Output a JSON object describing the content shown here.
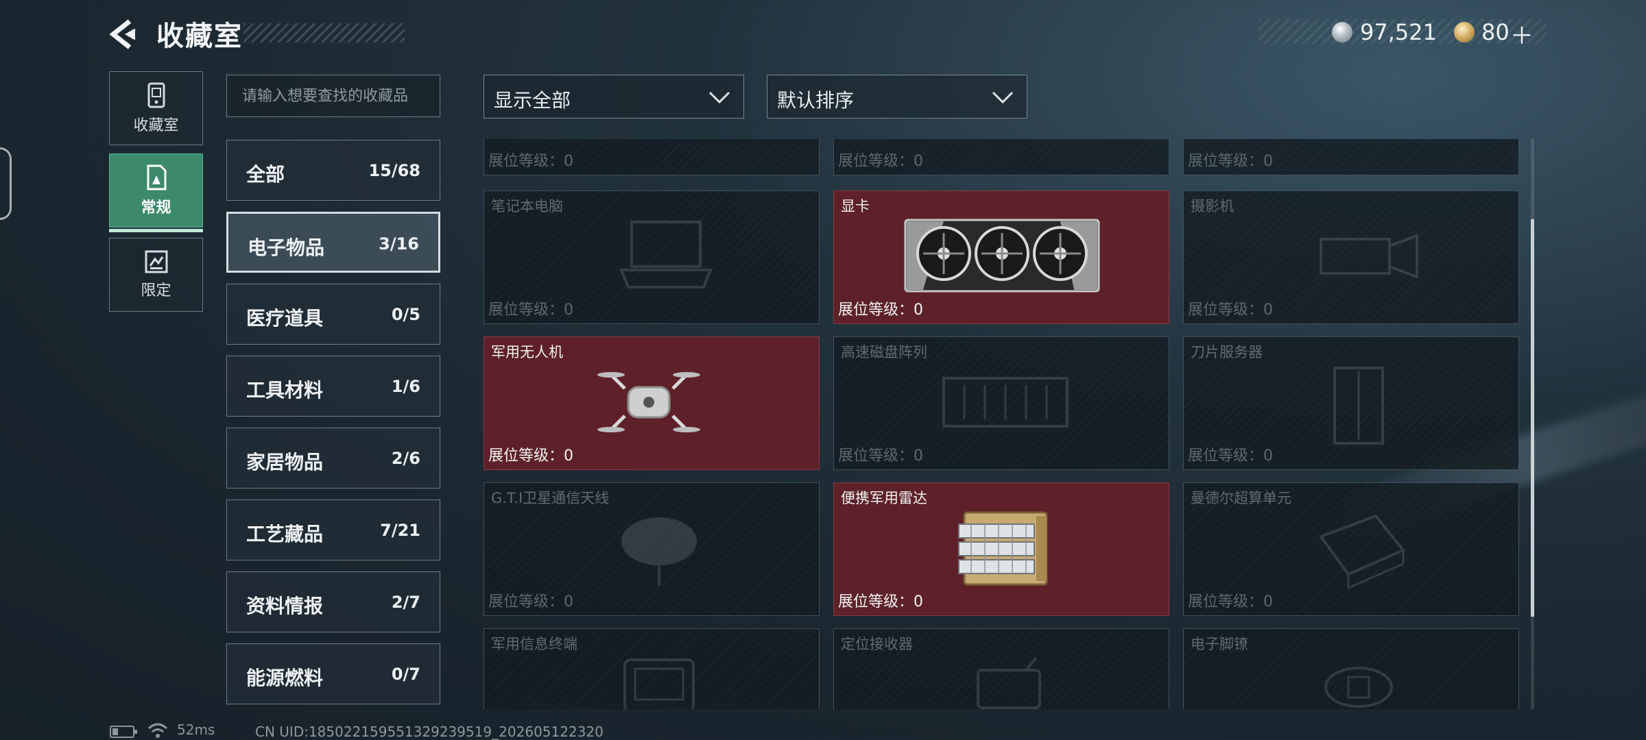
{
  "header": {
    "title": "收藏室",
    "back_icon": "back-arrow-icon"
  },
  "currency": {
    "silver_amount": "97,521",
    "gold_amount": "80",
    "gold_plus": "＋",
    "silver_icon": "silver-coin-icon",
    "gold_icon": "gold-coin-icon"
  },
  "side_tabs": [
    {
      "label": "收藏室",
      "icon": "collection-icon",
      "active": false
    },
    {
      "label": "常规",
      "icon": "regular-card-icon",
      "active": true
    },
    {
      "label": "限定",
      "icon": "limited-icon",
      "active": false
    }
  ],
  "search": {
    "placeholder": "请输入想要查找的收藏品"
  },
  "filters": {
    "show": "显示全部",
    "sort": "默认排序"
  },
  "categories": [
    {
      "name": "全部",
      "count": "15/68"
    },
    {
      "name": "电子物品",
      "count": "3/16",
      "active": true
    },
    {
      "name": "医疗道具",
      "count": "0/5"
    },
    {
      "name": "工具材料",
      "count": "1/6"
    },
    {
      "name": "家居物品",
      "count": "2/6"
    },
    {
      "name": "工艺藏品",
      "count": "7/21"
    },
    {
      "name": "资料情报",
      "count": "2/7"
    },
    {
      "name": "能源燃料",
      "count": "0/7"
    }
  ],
  "items": [
    {
      "name": "",
      "level": "展位等级：0",
      "owned": false
    },
    {
      "name": "",
      "level": "展位等级：0",
      "owned": false
    },
    {
      "name": "",
      "level": "展位等级：0",
      "owned": false
    },
    {
      "name": "笔记本电脑",
      "level": "展位等级：0",
      "owned": false,
      "icon": "laptop-icon"
    },
    {
      "name": "显卡",
      "level": "展位等级：0",
      "owned": true,
      "icon": "graphics-card-icon"
    },
    {
      "name": "摄影机",
      "level": "展位等级：0",
      "owned": false,
      "icon": "camera-icon"
    },
    {
      "name": "军用无人机",
      "level": "展位等级：0",
      "owned": true,
      "icon": "drone-icon"
    },
    {
      "name": "高速磁盘阵列",
      "level": "展位等级：0",
      "owned": false,
      "icon": "disk-array-icon"
    },
    {
      "name": "刀片服务器",
      "level": "展位等级：0",
      "owned": false,
      "icon": "blade-server-icon"
    },
    {
      "name": "G.T.I卫星通信天线",
      "level": "展位等级：0",
      "owned": false,
      "icon": "satellite-dish-icon"
    },
    {
      "name": "便携军用雷达",
      "level": "展位等级：0",
      "owned": true,
      "icon": "radar-icon"
    },
    {
      "name": "曼德尔超算单元",
      "level": "展位等级：0",
      "owned": false,
      "icon": "supercomputer-unit-icon"
    },
    {
      "name": "军用信息终端",
      "level": "",
      "owned": false,
      "icon": "info-terminal-icon"
    },
    {
      "name": "定位接收器",
      "level": "",
      "owned": false,
      "icon": "locator-icon"
    },
    {
      "name": "电子脚镣",
      "level": "",
      "owned": false,
      "icon": "ankle-monitor-icon"
    }
  ],
  "footer": {
    "ping": "52ms",
    "uid": "CN UID:185022159551329239519_202605122320",
    "battery_icon": "battery-icon",
    "wifi_icon": "wifi-icon"
  },
  "colors": {
    "owned_card": "#5e2129",
    "active_tab": "#3c8a6b"
  }
}
